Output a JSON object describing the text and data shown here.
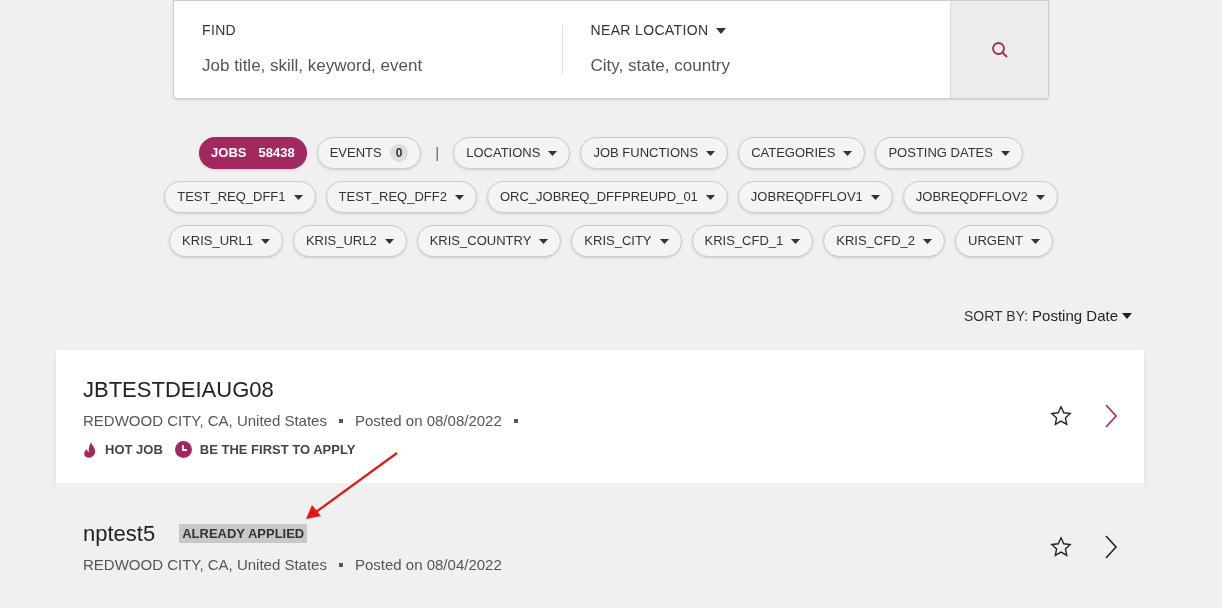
{
  "search": {
    "find_label": "FIND",
    "find_placeholder": "Job title, skill, keyword, event",
    "location_label": "NEAR LOCATION",
    "location_placeholder": "City, state, country"
  },
  "tabs": [
    {
      "label": "JOBS",
      "count": "58438",
      "selected": true
    },
    {
      "label": "EVENTS",
      "count": "0",
      "selected": false
    }
  ],
  "separator": "|",
  "filter_rows": [
    [
      "LOCATIONS",
      "JOB FUNCTIONS",
      "CATEGORIES",
      "POSTING DATES"
    ],
    [
      "TEST_REQ_DFF1",
      "TEST_REQ_DFF2",
      "ORC_JOBREQ_DFFPREUPD_01",
      "JOBREQDFFLOV1",
      "JOBREQDFFLOV2"
    ],
    [
      "KRIS_URL1",
      "KRIS_URL2",
      "KRIS_COUNTRY",
      "KRIS_CITY",
      "KRIS_CFD_1",
      "KRIS_CFD_2",
      "URGENT"
    ]
  ],
  "sort": {
    "label": "SORT BY:",
    "value": "Posting Date"
  },
  "jobs": [
    {
      "title": "JBTESTDEIAUG08",
      "location": "REDWOOD CITY, CA, United States",
      "posted": "Posted on 08/08/2022",
      "highlighted": true,
      "tags": [
        {
          "kind": "hot",
          "label": "HOT JOB"
        },
        {
          "kind": "first",
          "label": "BE THE FIRST TO APPLY"
        }
      ]
    },
    {
      "title": "nptest5",
      "location": "REDWOOD CITY, CA, United States",
      "posted": "Posted on 08/04/2022",
      "highlighted": false,
      "applied_badge": "ALREADY APPLIED"
    }
  ]
}
